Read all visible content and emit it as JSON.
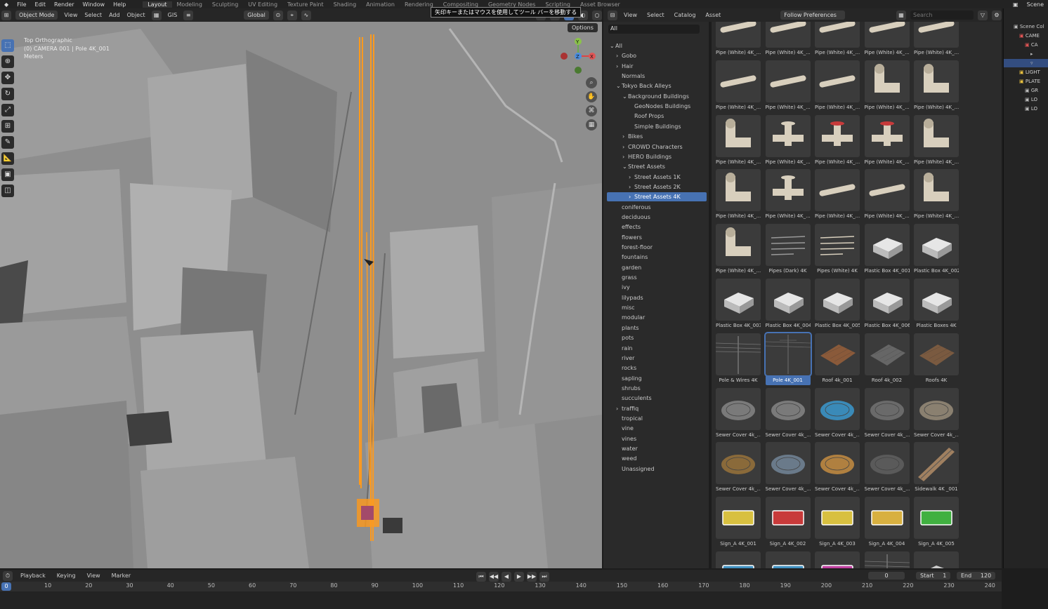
{
  "menubar": {
    "items": [
      "File",
      "Edit",
      "Render",
      "Window",
      "Help"
    ],
    "workspaces": [
      "Layout",
      "Modeling",
      "Sculpting",
      "UV Editing",
      "Texture Paint",
      "Shading",
      "Animation",
      "Rendering",
      "Compositing",
      "Geometry Nodes",
      "Scripting",
      "Asset Browser"
    ],
    "active_workspace": "Layout",
    "scene": "Scene"
  },
  "viewport": {
    "mode": "Object Mode",
    "menus": [
      "View",
      "Select",
      "Add",
      "Object"
    ],
    "gis": "GIS",
    "orientation": "Global",
    "options": "Options",
    "view_name": "Top Orthographic",
    "collection_info": "(0) CAMERA 001 | Pole 4K_001",
    "units": "Meters",
    "tooltip": "矢印キーまたはマウスを使用してツール バーを移動する",
    "gizmo": {
      "y": "Y",
      "z": "Z",
      "x": "X"
    }
  },
  "asset_browser": {
    "menus": [
      "View",
      "Select",
      "Catalog",
      "Asset"
    ],
    "import": "Follow Preferences",
    "search_placeholder": "Search",
    "filter": "All",
    "tree": [
      {
        "label": "All",
        "indent": 0,
        "arrow": "v"
      },
      {
        "label": "Gobo",
        "indent": 1,
        "arrow": ">"
      },
      {
        "label": "Hair",
        "indent": 1,
        "arrow": ">"
      },
      {
        "label": "Normals",
        "indent": 1,
        "arrow": ""
      },
      {
        "label": "Tokyo Back Alleys",
        "indent": 1,
        "arrow": "v"
      },
      {
        "label": "Background Buildings",
        "indent": 2,
        "arrow": "v"
      },
      {
        "label": "GeoNodes Buildings",
        "indent": 3,
        "arrow": ""
      },
      {
        "label": "Roof Props",
        "indent": 3,
        "arrow": ""
      },
      {
        "label": "Simple Buildings",
        "indent": 3,
        "arrow": ""
      },
      {
        "label": "Bikes",
        "indent": 2,
        "arrow": ">"
      },
      {
        "label": "CROWD Characters",
        "indent": 2,
        "arrow": ">"
      },
      {
        "label": "HERO Buildings",
        "indent": 2,
        "arrow": ">"
      },
      {
        "label": "Street Assets",
        "indent": 2,
        "arrow": "v"
      },
      {
        "label": "Street Assets 1K",
        "indent": 3,
        "arrow": ">"
      },
      {
        "label": "Street Assets 2K",
        "indent": 3,
        "arrow": ">"
      },
      {
        "label": "Street Assets 4K",
        "indent": 3,
        "arrow": ">",
        "selected": true
      },
      {
        "label": "coniferous",
        "indent": 1,
        "arrow": ""
      },
      {
        "label": "deciduous",
        "indent": 1,
        "arrow": ""
      },
      {
        "label": "effects",
        "indent": 1,
        "arrow": ""
      },
      {
        "label": "flowers",
        "indent": 1,
        "arrow": ""
      },
      {
        "label": "forest-floor",
        "indent": 1,
        "arrow": ""
      },
      {
        "label": "fountains",
        "indent": 1,
        "arrow": ""
      },
      {
        "label": "garden",
        "indent": 1,
        "arrow": ""
      },
      {
        "label": "grass",
        "indent": 1,
        "arrow": ""
      },
      {
        "label": "ivy",
        "indent": 1,
        "arrow": ""
      },
      {
        "label": "lilypads",
        "indent": 1,
        "arrow": ""
      },
      {
        "label": "misc",
        "indent": 1,
        "arrow": ""
      },
      {
        "label": "modular",
        "indent": 1,
        "arrow": ""
      },
      {
        "label": "plants",
        "indent": 1,
        "arrow": ""
      },
      {
        "label": "pots",
        "indent": 1,
        "arrow": ""
      },
      {
        "label": "rain",
        "indent": 1,
        "arrow": ""
      },
      {
        "label": "river",
        "indent": 1,
        "arrow": ""
      },
      {
        "label": "rocks",
        "indent": 1,
        "arrow": ""
      },
      {
        "label": "sapling",
        "indent": 1,
        "arrow": ""
      },
      {
        "label": "shrubs",
        "indent": 1,
        "arrow": ""
      },
      {
        "label": "succulents",
        "indent": 1,
        "arrow": ""
      },
      {
        "label": "traffiq",
        "indent": 1,
        "arrow": ">"
      },
      {
        "label": "tropical",
        "indent": 1,
        "arrow": ""
      },
      {
        "label": "vine",
        "indent": 1,
        "arrow": ""
      },
      {
        "label": "vines",
        "indent": 1,
        "arrow": ""
      },
      {
        "label": "water",
        "indent": 1,
        "arrow": ""
      },
      {
        "label": "weed",
        "indent": 1,
        "arrow": ""
      },
      {
        "label": "Unassigned",
        "indent": 1,
        "arrow": ""
      }
    ],
    "assets": [
      {
        "label": "Pipe (White) 4K_...",
        "kind": "pipe",
        "color": "#d8cfbd"
      },
      {
        "label": "Pipe (White) 4K_...",
        "kind": "pipe",
        "color": "#d8cfbd"
      },
      {
        "label": "Pipe (White) 4K_...",
        "kind": "pipe",
        "color": "#d8cfbd"
      },
      {
        "label": "Pipe (White) 4K_...",
        "kind": "pipe",
        "color": "#d8cfbd"
      },
      {
        "label": "Pipe (White) 4K_...",
        "kind": "pipe",
        "color": "#d8cfbd"
      },
      {
        "label": "Pipe (White) 4K_...",
        "kind": "pipe",
        "color": "#d8cfbd"
      },
      {
        "label": "Pipe (White) 4K_...",
        "kind": "pipe",
        "color": "#d8cfbd"
      },
      {
        "label": "Pipe (White) 4K_...",
        "kind": "pipe",
        "color": "#d8cfbd"
      },
      {
        "label": "Pipe (White) 4K_...",
        "kind": "elbow",
        "color": "#d8cfbd"
      },
      {
        "label": "Pipe (White) 4K_...",
        "kind": "elbow",
        "color": "#d8cfbd"
      },
      {
        "label": "Pipe (White) 4K_...",
        "kind": "elbow",
        "color": "#d8cfbd"
      },
      {
        "label": "Pipe (White) 4K_...",
        "kind": "valve",
        "color": "#d8cfbd"
      },
      {
        "label": "Pipe (White) 4K_...",
        "kind": "valve",
        "color": "#c83a3a"
      },
      {
        "label": "Pipe (White) 4K_...",
        "kind": "valve",
        "color": "#c83a3a"
      },
      {
        "label": "Pipe (White) 4K_...",
        "kind": "elbow",
        "color": "#d8cfbd"
      },
      {
        "label": "Pipe (White) 4K_...",
        "kind": "elbow",
        "color": "#d8cfbd"
      },
      {
        "label": "Pipe (White) 4K_...",
        "kind": "valve",
        "color": "#d8cfbd"
      },
      {
        "label": "Pipe (White) 4K_...",
        "kind": "pipe",
        "color": "#d8cfbd"
      },
      {
        "label": "Pipe (White) 4K_...",
        "kind": "pipe",
        "color": "#d8cfbd"
      },
      {
        "label": "Pipe (White) 4K_...",
        "kind": "elbow",
        "color": "#d8cfbd"
      },
      {
        "label": "Pipe (White) 4K_...",
        "kind": "elbow",
        "color": "#d8cfbd"
      },
      {
        "label": "Pipes (Dark) 4K",
        "kind": "lines",
        "color": "#999999"
      },
      {
        "label": "Pipes (White) 4K",
        "kind": "lines",
        "color": "#d8cfbd"
      },
      {
        "label": "Plastic Box 4K_001",
        "kind": "box",
        "color": "#e6e6e6"
      },
      {
        "label": "Plastic Box 4K_002",
        "kind": "box",
        "color": "#e6e6e6"
      },
      {
        "label": "Plastic Box 4K_003",
        "kind": "box",
        "color": "#e6e6e6"
      },
      {
        "label": "Plastic Box 4K_004",
        "kind": "box",
        "color": "#e6e6e6"
      },
      {
        "label": "Plastic Box 4K_005",
        "kind": "box",
        "color": "#e6e6e6"
      },
      {
        "label": "Plastic Box 4K_006",
        "kind": "box",
        "color": "#e6e6e6"
      },
      {
        "label": "Plastic Boxes 4K",
        "kind": "box",
        "color": "#e6e6e6"
      },
      {
        "label": "Pole & Wires 4K",
        "kind": "wires",
        "color": "#999999"
      },
      {
        "label": "Pole 4K_001",
        "kind": "pole",
        "color": "#999999",
        "selected": true
      },
      {
        "label": "Roof 4k_001",
        "kind": "roof",
        "color": "#8a5a3a"
      },
      {
        "label": "Roof 4k_002",
        "kind": "roof",
        "color": "#666666"
      },
      {
        "label": "Roofs 4K",
        "kind": "roof",
        "color": "#7a5a40"
      },
      {
        "label": "Sewer Cover 4k_...",
        "kind": "disc",
        "color": "#7a7a7a"
      },
      {
        "label": "Sewer Cover 4k_...",
        "kind": "disc",
        "color": "#7a7a7a"
      },
      {
        "label": "Sewer Cover 4k_...",
        "kind": "disc",
        "color": "#3a8ab8"
      },
      {
        "label": "Sewer Cover 4k_...",
        "kind": "disc",
        "color": "#6a6a6a"
      },
      {
        "label": "Sewer Cover 4k_...",
        "kind": "disc",
        "color": "#8a8070"
      },
      {
        "label": "Sewer Cover 4k_...",
        "kind": "disc",
        "color": "#8a6a3a"
      },
      {
        "label": "Sewer Cover 4k_...",
        "kind": "disc",
        "color": "#6a7a8a"
      },
      {
        "label": "Sewer Cover 4k_...",
        "kind": "disc",
        "color": "#b08040"
      },
      {
        "label": "Sewer Cover 4k_...",
        "kind": "disc",
        "color": "#5a5a5a"
      },
      {
        "label": "Sidewalk 4K _001",
        "kind": "plank",
        "color": "#a08060"
      },
      {
        "label": "Sign_A 4K_001",
        "kind": "sign",
        "color": "#d8c040"
      },
      {
        "label": "Sign_A 4K_002",
        "kind": "sign",
        "color": "#c83a3a"
      },
      {
        "label": "Sign_A 4K_003",
        "kind": "sign",
        "color": "#d8c040"
      },
      {
        "label": "Sign_A 4K_004",
        "kind": "sign",
        "color": "#d8b040"
      },
      {
        "label": "Sign_A 4K_005",
        "kind": "sign",
        "color": "#40b040"
      },
      {
        "label": "",
        "kind": "sign",
        "color": "#4090c0"
      },
      {
        "label": "",
        "kind": "sign",
        "color": "#4090c0"
      },
      {
        "label": "",
        "kind": "sign",
        "color": "#c040a0"
      },
      {
        "label": "",
        "kind": "wires",
        "color": "#999999"
      },
      {
        "label": "",
        "kind": "box",
        "color": "#cccccc"
      }
    ]
  },
  "outliner": {
    "items": [
      {
        "label": "Scene Col"
      },
      {
        "label": "CAME"
      },
      {
        "label": "CA"
      },
      {
        "label": ""
      },
      {
        "label": "",
        "selected": true
      },
      {
        "label": "LIGHT"
      },
      {
        "label": "PLATE"
      },
      {
        "label": "GR"
      },
      {
        "label": "LO"
      },
      {
        "label": "LO"
      }
    ]
  },
  "timeline": {
    "menus": [
      "Playback",
      "Keying",
      "View",
      "Marker"
    ],
    "current_frame": "0",
    "start_label": "Start",
    "start": "1",
    "end_label": "End",
    "end": "120",
    "ticks": [
      "10",
      "20",
      "30",
      "40",
      "50",
      "60",
      "70",
      "80",
      "90",
      "100",
      "110",
      "120",
      "130",
      "140",
      "150",
      "160",
      "170",
      "180",
      "190",
      "200",
      "210",
      "220",
      "230",
      "240"
    ],
    "playhead": "0"
  }
}
